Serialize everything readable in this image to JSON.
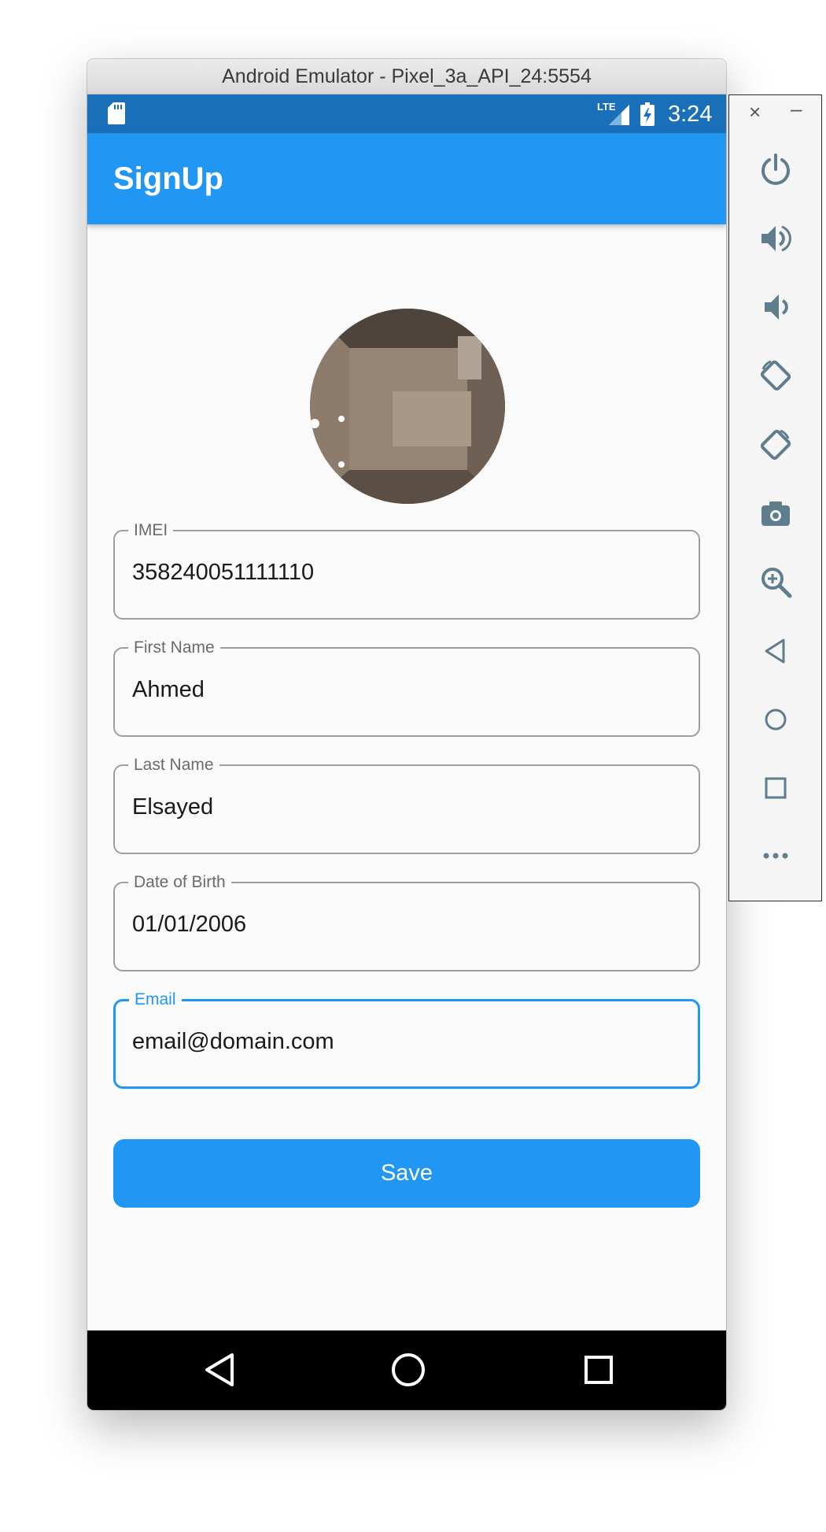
{
  "window": {
    "title": "Android Emulator - Pixel_3a_API_24:5554"
  },
  "status_bar": {
    "network": "LTE",
    "time": "3:24"
  },
  "app_bar": {
    "title": "SignUp"
  },
  "form": {
    "fields": [
      {
        "label": "IMEI",
        "value": "358240051111110"
      },
      {
        "label": "First Name",
        "value": "Ahmed"
      },
      {
        "label": "Last Name",
        "value": "Elsayed"
      },
      {
        "label": "Date of Birth",
        "value": "01/01/2006"
      },
      {
        "label": "Email",
        "value": "email@domain.com",
        "focused": true
      }
    ],
    "save_label": "Save"
  },
  "nav_bar": {
    "buttons": [
      "back-icon",
      "home-icon",
      "recents-icon"
    ]
  },
  "side_panel": {
    "close": "×",
    "minimize": "–",
    "controls": [
      "power-icon",
      "volume-up-icon",
      "volume-down-icon",
      "rotate-left-icon",
      "rotate-right-icon",
      "camera-icon",
      "zoom-icon",
      "back-icon",
      "home-icon",
      "overview-icon",
      "more-icon"
    ]
  },
  "colors": {
    "primary": "#2196f3",
    "status_bar": "#1a6fb9",
    "background": "#fafafa"
  }
}
